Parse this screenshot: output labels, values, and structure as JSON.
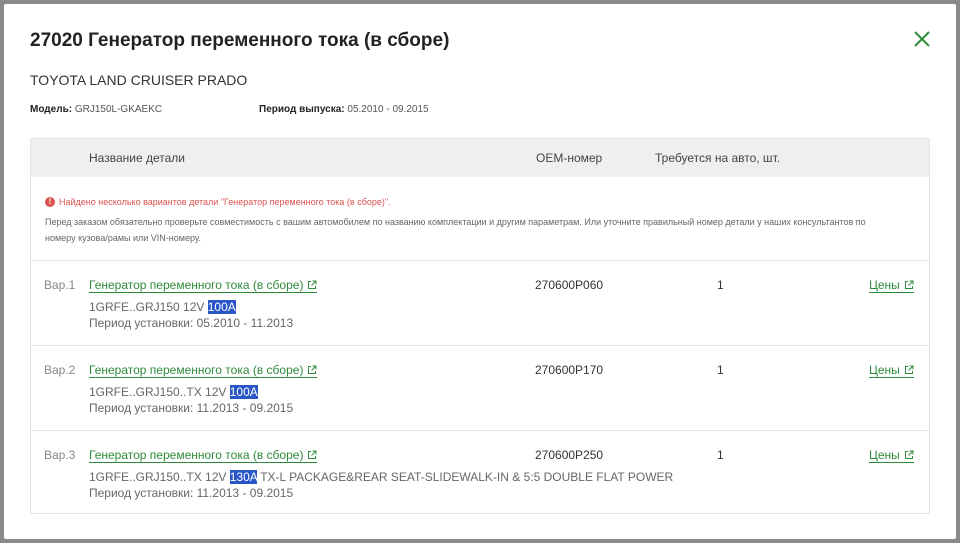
{
  "modal": {
    "title": "27020 Генератор переменного тока (в сборе)",
    "car": "TOYOTA LAND CRUISER PRADO",
    "model_label": "Модель",
    "model_value": "GRJ150L-GKAEKC",
    "period_label": "Период выпуска",
    "period_value": "05.2010 - 09.2015"
  },
  "table": {
    "headers": {
      "name": "Название детали",
      "oem": "OEM-номер",
      "qty": "Требуется на авто, шт."
    },
    "warning": "Найдено несколько вариантов детали \"Генератор переменного тока (в сборе)\".",
    "warning_desc": "Перед заказом обязательно проверьте совместимость с вашим автомобилем по названию комплектации и другим параметрам. Или уточните правильный номер детали у наших консультантов по номеру кузова/рамы или VIN-номеру.",
    "rows": [
      {
        "variant": "Вар.1",
        "name": "Генератор переменного тока (в сборе)",
        "spec_pre": "1GRFE..GRJ150 12V ",
        "spec_hl": "100A",
        "spec_post": "",
        "period": "Период установки: 05.2010 - 11.2013",
        "oem": "270600P060",
        "qty": "1",
        "price": "Цены"
      },
      {
        "variant": "Вар.2",
        "name": "Генератор переменного тока (в сборе)",
        "spec_pre": "1GRFE..GRJ150..TX 12V ",
        "spec_hl": "100A",
        "spec_post": "",
        "period": "Период установки: 11.2013 - 09.2015",
        "oem": "270600P170",
        "qty": "1",
        "price": "Цены"
      },
      {
        "variant": "Вар.3",
        "name": "Генератор переменного тока (в сборе)",
        "spec_pre": "1GRFE..GRJ150..TX 12V ",
        "spec_hl": "130A",
        "spec_post": " TX-L PACKAGE&REAR SEAT-SLIDEWALK-IN & 5:5 DOUBLE FLAT POWER",
        "period": "Период установки: 11.2013 - 09.2015",
        "oem": "270600P250",
        "qty": "1",
        "price": "Цены"
      }
    ]
  },
  "colors": {
    "accent_green": "#2e8b3a",
    "warning_red": "#d9534f",
    "highlight_blue": "#2a57c8"
  },
  "icons": {
    "close": "close-icon",
    "external_link": "external-link-icon",
    "warning": "exclamation-circle-icon"
  }
}
